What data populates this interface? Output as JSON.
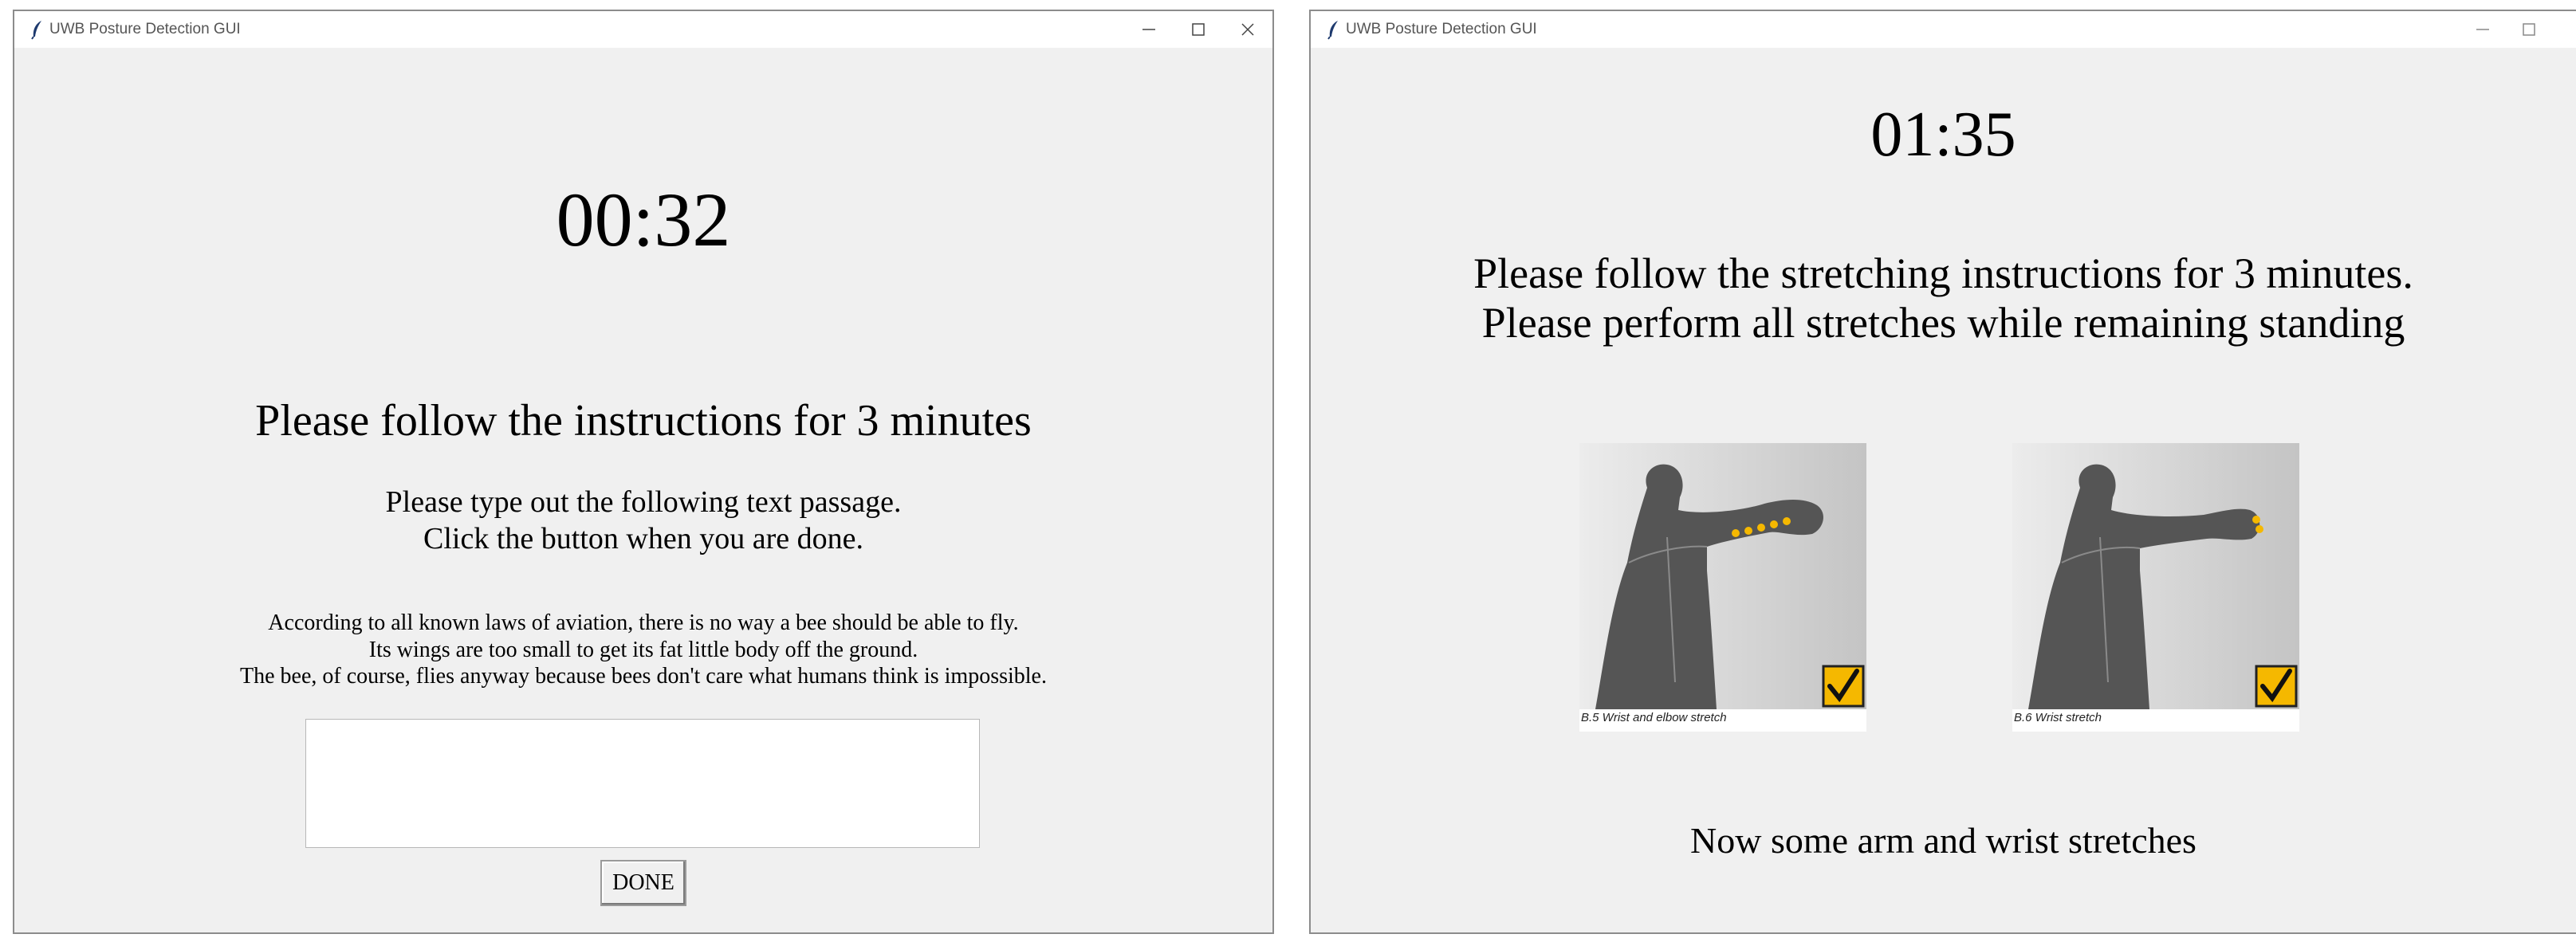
{
  "left_window": {
    "title": "UWB Posture Detection GUI",
    "timer": "00:32",
    "heading": "Please follow the instructions for 3 minutes",
    "instructions": [
      "Please type out the following text passage.",
      "Click the button when you are done."
    ],
    "passage": [
      "According to all known laws of aviation, there is no way a bee should be able to fly.",
      "Its wings are too small to get its fat little body off the ground.",
      "The bee, of course, flies anyway because bees don't care what humans think is impossible."
    ],
    "text_input_value": "",
    "done_label": "DONE"
  },
  "right_window": {
    "title": "UWB Posture Detection GUI",
    "timer": "01:35",
    "heading": [
      "Please follow the stretching instructions for 3 minutes.",
      "Please perform all stretches while remaining standing"
    ],
    "stretches": [
      {
        "caption": "B.5 Wrist and elbow stretch",
        "icon": "check-icon"
      },
      {
        "caption": "B.6 Wrist stretch",
        "icon": "check-icon"
      }
    ],
    "footer": "Now some arm and wrist stretches"
  },
  "colors": {
    "window_bg": "#f0f0f0",
    "titlebar_bg": "#ffffff",
    "figure_grey": "#555555",
    "highlight": "#f5b800",
    "checkbox_bg": "#f5b800"
  }
}
